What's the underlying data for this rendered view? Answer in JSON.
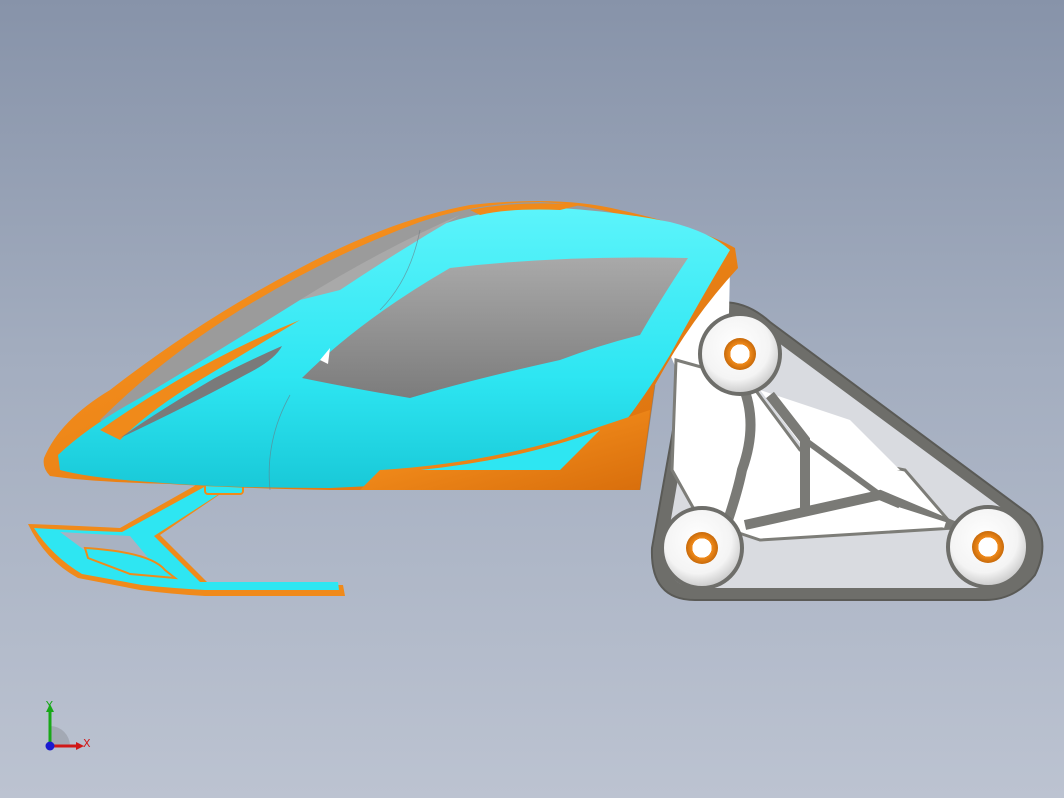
{
  "viewport": {
    "background_top": "#8793a9",
    "background_bottom": "#bcc3d1"
  },
  "model": {
    "name": "snowmobile",
    "colors": {
      "body_cyan": "#2ee6f2",
      "accent_orange": "#f08a1a",
      "canopy_gray": "#8c8c8c",
      "frame_gray": "#7d7d78",
      "bracket_white": "#ffffff",
      "track_gray": "#6e6e6a"
    },
    "parts": [
      "body-shell",
      "canopy-window",
      "front-ski",
      "ski-mount",
      "rear-track",
      "drive-wheel",
      "idler-wheel-front",
      "idler-wheel-rear",
      "suspension-bracket"
    ]
  },
  "triad": {
    "x_label": "X",
    "y_label": "Y",
    "x_color": "#d01818",
    "y_color": "#18a818",
    "z_color": "#1a1ad0"
  }
}
